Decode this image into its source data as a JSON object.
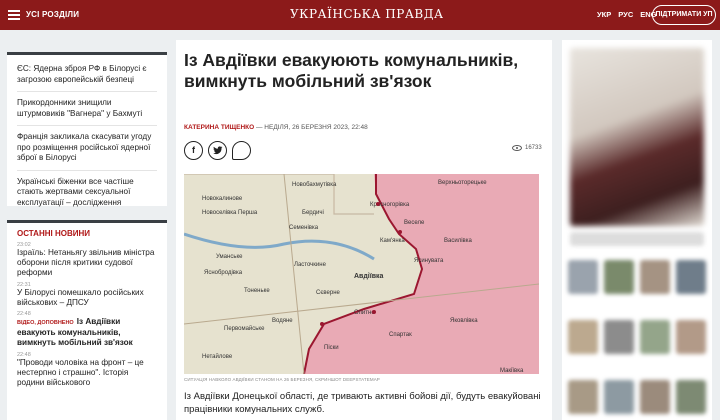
{
  "header": {
    "sections_label": "УСІ РОЗДІЛИ",
    "logo_text": "УКРАЇНСЬКА ПРАВДА",
    "languages": [
      "УКР",
      "РУС",
      "ENG"
    ],
    "support_label": "ПІДТРИМАТИ УП"
  },
  "top_links": [
    "ЄС: Ядерна зброя РФ в Білорусі є загрозою європейській безпеці",
    "Прикордонники знищили штурмовиків \"Вагнера\" у Бахмуті",
    "Франція закликала скасувати угоду про розміщення російської ядерної зброї в Білорусі",
    "Українські біженки все частіше стають жертвами сексуальної експлуатації – дослідження"
  ],
  "latest_news": {
    "title": "ОСТАННІ НОВИНИ",
    "items": [
      {
        "time": "23:02",
        "text": "Ізраїль: Нетаньягу звільнив міністра оборони після критики судової реформи",
        "tag": "",
        "bold": false
      },
      {
        "time": "22:31",
        "text": "У Білорусі помешкало російських військових – ДПСУ",
        "tag": "",
        "bold": false
      },
      {
        "time": "22:48",
        "text": "Із Авдіївки евакують комунальників, вимкнуть мобільний зв'язок",
        "tag": "ВІДЕО, ДОПОВНЕНО",
        "bold": true
      },
      {
        "time": "22:48",
        "text": "\"Проводи чоловіка на фронт – це нестерпно і страшно\". Історія родини військового",
        "tag": "",
        "bold": false
      }
    ]
  },
  "article": {
    "headline": "Із Авдіївки евакуюють комунальників, вимкнуть мобільний зв'язок",
    "author": "КАТЕРИНА ТИЩЕНКО",
    "date": " — НЕДІЛЯ, 26 БЕРЕЗНЯ 2023, 22:48",
    "views": "16733",
    "share_icons": [
      "facebook-icon",
      "twitter-icon",
      "comment-icon"
    ],
    "map_caption": "СИТУАЦІЯ НАВКОЛО АВДІЇВКИ СТАНОМ НА 26 БЕРЕЗНЯ, СКРИНШОТ DEEPSTATEMAP",
    "lead": "Із Авдіївки Донецької області, де тривають активні бойові дії, будуть евакуйовані працівники комунальних служб."
  },
  "map_labels": {
    "towns": [
      "Новобахмутівка",
      "Верхньоторецьке",
      "Новокалинове",
      "Красногорівка",
      "Новоселівка Перша",
      "Бердичі",
      "Веселе",
      "Семенівка",
      "Кам'янка",
      "Василівка",
      "Уманське",
      "Ласточкине",
      "Опитне",
      "Яснобродівка",
      "Авдіївка",
      "Ясинувата",
      "Тоненьке",
      "Сєверне",
      "Спартак",
      "Водяне",
      "Яковлівка",
      "Первомайське",
      "Піски",
      "Макіївка",
      "Нетайлове",
      "Неvельське"
    ],
    "colors": {
      "occupied": "#e9aab5",
      "free": "#e6e2cf",
      "frontline": "#9b1730"
    }
  }
}
